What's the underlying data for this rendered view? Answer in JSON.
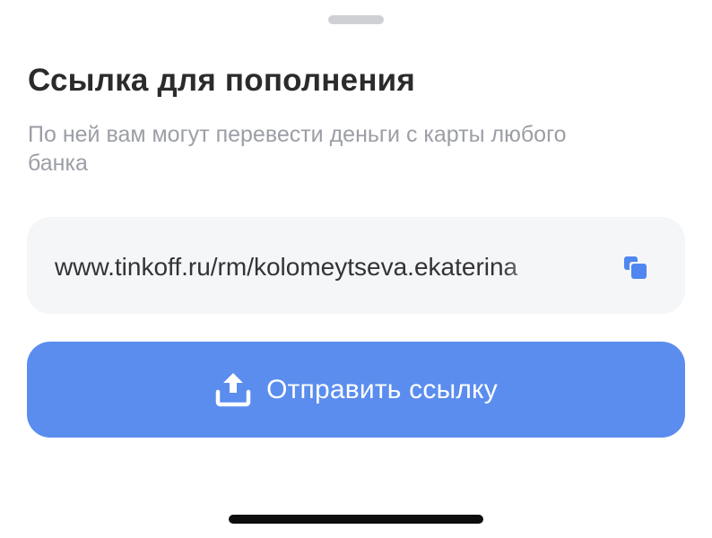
{
  "sheet": {
    "title": "Ссылка для пополнения",
    "subtitle": "По ней вам могут перевести деньги с карты любого банка"
  },
  "link": {
    "url": "www.tinkoff.ru/rm/kolomeytseva.ekaterina",
    "copy_icon": "copy-icon"
  },
  "send_button": {
    "label": "Отправить ссылку",
    "icon": "share-upload-icon"
  },
  "colors": {
    "accent": "#5b8def",
    "copy_icon": "#4f86f0",
    "title": "#2b2b2d",
    "subtitle": "#9c9ea6",
    "field_background": "#f5f6f8"
  }
}
